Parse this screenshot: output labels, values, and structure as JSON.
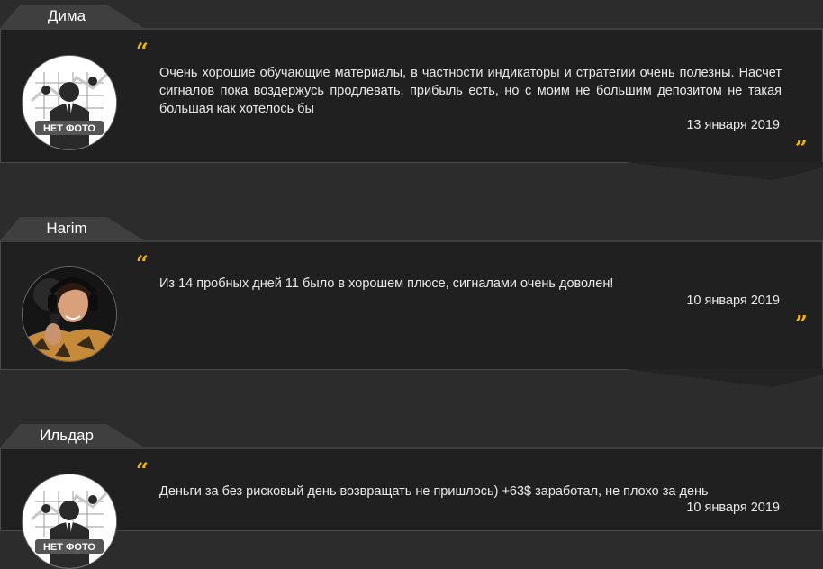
{
  "reviews": [
    {
      "name": "Дима",
      "avatar": "placeholder",
      "avatar_label": "НЕТ ФОТО",
      "text": "Очень хорошие обучающие материалы, в частности индикаторы и стратегии очень полезны. Насчет сигналов пока воздержусь продлевать, прибыль есть, но с моим не большим депозитом не такая большая как хотелось бы",
      "date": "13 января 2019"
    },
    {
      "name": "Harim",
      "avatar": "photo",
      "text": "Из 14 пробных дней 11 было в хорошем плюсе, сигналами очень доволен!",
      "date": "10 января 2019"
    },
    {
      "name": "Ильдар",
      "avatar": "placeholder",
      "avatar_label": "НЕТ ФОТО",
      "text": "Деньги за без рисковый день возвращать не пришлось) +63$ заработал, не плохо за день",
      "date": "10 января 2019"
    }
  ],
  "quote_open": "“",
  "quote_close": "”",
  "colors": {
    "background": "#2c2c2c",
    "card": "#202020",
    "tab": "#3f3f3f",
    "quote_accent": "#f2b705"
  },
  "icons": {
    "quote": "quote-mark-icon",
    "no_photo": "no-photo-icon"
  }
}
